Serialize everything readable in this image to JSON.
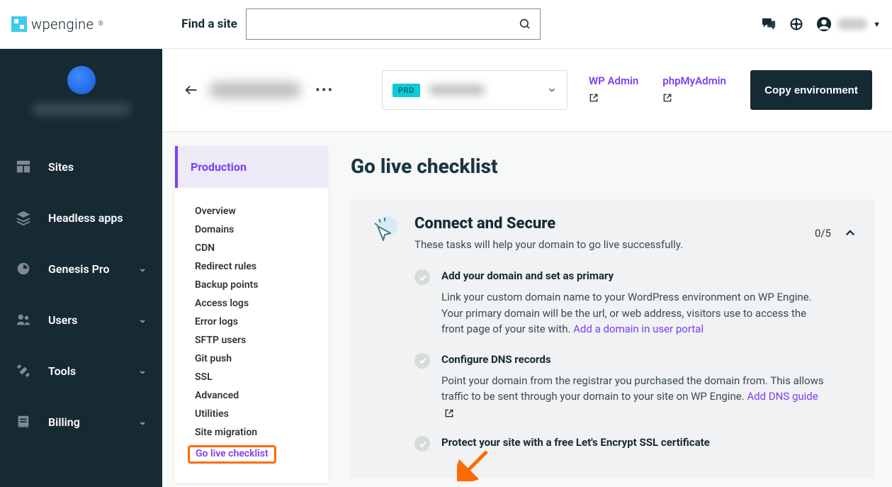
{
  "logo_text": "wpengine",
  "search": {
    "label": "Find a site",
    "placeholder": ""
  },
  "sidebar": {
    "items": [
      {
        "label": "Sites",
        "icon": "sites"
      },
      {
        "label": "Headless apps",
        "icon": "layers"
      },
      {
        "label": "Genesis Pro",
        "icon": "genesis",
        "expandable": true
      },
      {
        "label": "Users",
        "icon": "users",
        "expandable": true
      },
      {
        "label": "Tools",
        "icon": "tools",
        "expandable": true
      },
      {
        "label": "Billing",
        "icon": "billing",
        "expandable": true
      }
    ]
  },
  "env_header": {
    "badge": "PRD",
    "links": [
      {
        "label": "WP Admin"
      },
      {
        "label": "phpMyAdmin"
      }
    ],
    "copy_button": "Copy environment"
  },
  "sub_sidebar": {
    "header": "Production",
    "items": [
      "Overview",
      "Domains",
      "CDN",
      "Redirect rules",
      "Backup points",
      "Access logs",
      "Error logs",
      "SFTP users",
      "Git push",
      "SSL",
      "Advanced",
      "Utilities",
      "Site migration",
      "Go live checklist"
    ],
    "active_index": 13
  },
  "page": {
    "title": "Go live checklist",
    "section": {
      "title": "Connect and Secure",
      "subtitle": "These tasks will help your domain to go live successfully.",
      "progress": "0/5",
      "tasks": [
        {
          "title": "Add your domain and set as primary",
          "desc": "Link your custom domain name to your WordPress environment on WP Engine. Your primary domain will be the url, or web address, visitors use to access the front page of your site with. ",
          "link_text": "Add a domain in user portal"
        },
        {
          "title": "Configure DNS records",
          "desc": "Point your domain from the registrar you purchased the domain from. This allows traffic to be sent through your domain to your site on WP Engine. ",
          "link_text": "Add DNS guide",
          "external": true
        },
        {
          "title": "Protect your site with a free Let's Encrypt SSL certificate",
          "desc": "",
          "link_text": ""
        }
      ]
    }
  }
}
